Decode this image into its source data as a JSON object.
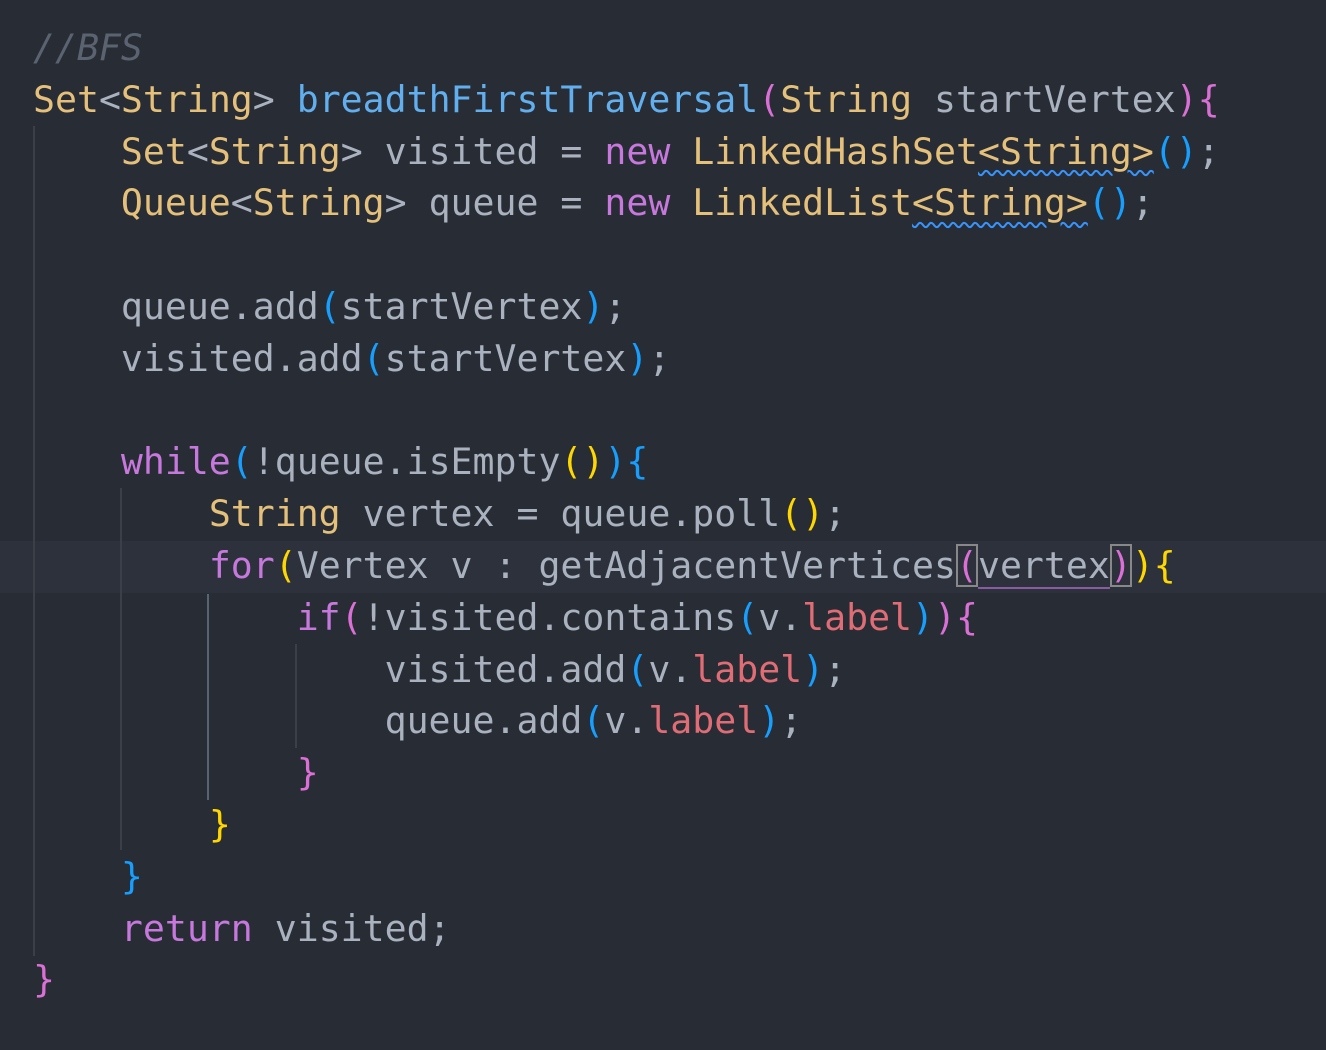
{
  "editor": {
    "language": "java",
    "colors": {
      "background": "#282c34",
      "current_line": "#2c313c",
      "comment": "#5c6370",
      "type": "#e5c07b",
      "function": "#61afef",
      "keyword": "#c678dd",
      "property": "#e06c75",
      "text": "#abb2bf"
    },
    "lines": [
      {
        "tokens": [
          {
            "t": "//BFS",
            "c": "comment"
          }
        ]
      },
      {
        "tokens": [
          {
            "t": "Set",
            "c": "type"
          },
          {
            "t": "<",
            "c": "plain"
          },
          {
            "t": "String",
            "c": "type"
          },
          {
            "t": "> ",
            "c": "plain"
          },
          {
            "t": "breadthFirstTraversal",
            "c": "fn"
          },
          {
            "t": "(",
            "c": "bp"
          },
          {
            "t": "String",
            "c": "type"
          },
          {
            "t": " startVertex",
            "c": "plain"
          },
          {
            "t": "){",
            "c": "bp"
          }
        ]
      },
      {
        "tokens": [
          {
            "t": "    "
          },
          {
            "t": "Set",
            "c": "type"
          },
          {
            "t": "<",
            "c": "plain"
          },
          {
            "t": "String",
            "c": "type"
          },
          {
            "t": "> visited = ",
            "c": "plain"
          },
          {
            "t": "new",
            "c": "kw"
          },
          {
            "t": " ",
            "c": "plain"
          },
          {
            "t": "LinkedHashSet",
            "c": "type"
          },
          {
            "t": "<String>",
            "c": "type",
            "squiggle": true
          },
          {
            "t": "()",
            "c": "bb"
          },
          {
            "t": ";",
            "c": "plain"
          }
        ]
      },
      {
        "tokens": [
          {
            "t": "    "
          },
          {
            "t": "Queue",
            "c": "type"
          },
          {
            "t": "<",
            "c": "plain"
          },
          {
            "t": "String",
            "c": "type"
          },
          {
            "t": "> queue = ",
            "c": "plain"
          },
          {
            "t": "new",
            "c": "kw"
          },
          {
            "t": " ",
            "c": "plain"
          },
          {
            "t": "LinkedList",
            "c": "type"
          },
          {
            "t": "<String>",
            "c": "type",
            "squiggle": true
          },
          {
            "t": "()",
            "c": "bb"
          },
          {
            "t": ";",
            "c": "plain"
          }
        ]
      },
      {
        "tokens": []
      },
      {
        "tokens": [
          {
            "t": "    "
          },
          {
            "t": "queue.add",
            "c": "plain"
          },
          {
            "t": "(",
            "c": "bb"
          },
          {
            "t": "startVertex",
            "c": "plain"
          },
          {
            "t": ")",
            "c": "bb"
          },
          {
            "t": ";",
            "c": "plain"
          }
        ]
      },
      {
        "tokens": [
          {
            "t": "    "
          },
          {
            "t": "visited.add",
            "c": "plain"
          },
          {
            "t": "(",
            "c": "bb"
          },
          {
            "t": "startVertex",
            "c": "plain"
          },
          {
            "t": ")",
            "c": "bb"
          },
          {
            "t": ";",
            "c": "plain"
          }
        ]
      },
      {
        "tokens": []
      },
      {
        "tokens": [
          {
            "t": "    "
          },
          {
            "t": "while",
            "c": "kw"
          },
          {
            "t": "(",
            "c": "bb"
          },
          {
            "t": "!queue.isEmpty",
            "c": "plain"
          },
          {
            "t": "()",
            "c": "by"
          },
          {
            "t": "){",
            "c": "bb"
          }
        ]
      },
      {
        "tokens": [
          {
            "t": "        "
          },
          {
            "t": "String",
            "c": "type"
          },
          {
            "t": " vertex = queue.poll",
            "c": "plain"
          },
          {
            "t": "()",
            "c": "by"
          },
          {
            "t": ";",
            "c": "plain"
          }
        ]
      },
      {
        "tokens": [
          {
            "t": "        "
          },
          {
            "t": "for",
            "c": "kw"
          },
          {
            "t": "(",
            "c": "by"
          },
          {
            "t": "Vertex v : getAdjacentVertices",
            "c": "plain"
          },
          {
            "t": "(",
            "c": "bp",
            "match": true
          },
          {
            "t": "vertex",
            "c": "plain",
            "range": true
          },
          {
            "t": ")",
            "c": "bp",
            "match": true
          },
          {
            "t": ")",
            "c": "by"
          },
          {
            "t": "{",
            "c": "by"
          }
        ]
      },
      {
        "tokens": [
          {
            "t": "            "
          },
          {
            "t": "if",
            "c": "kw"
          },
          {
            "t": "(",
            "c": "bp"
          },
          {
            "t": "!visited.contains",
            "c": "plain"
          },
          {
            "t": "(",
            "c": "bb"
          },
          {
            "t": "v.",
            "c": "plain"
          },
          {
            "t": "label",
            "c": "prop"
          },
          {
            "t": ")",
            "c": "bb"
          },
          {
            "t": "){",
            "c": "bp"
          }
        ]
      },
      {
        "tokens": [
          {
            "t": "                "
          },
          {
            "t": "visited.add",
            "c": "plain"
          },
          {
            "t": "(",
            "c": "bb"
          },
          {
            "t": "v.",
            "c": "plain"
          },
          {
            "t": "label",
            "c": "prop"
          },
          {
            "t": ")",
            "c": "bb"
          },
          {
            "t": ";",
            "c": "plain"
          }
        ]
      },
      {
        "tokens": [
          {
            "t": "                "
          },
          {
            "t": "queue.add",
            "c": "plain"
          },
          {
            "t": "(",
            "c": "bb"
          },
          {
            "t": "v.",
            "c": "plain"
          },
          {
            "t": "label",
            "c": "prop"
          },
          {
            "t": ")",
            "c": "bb"
          },
          {
            "t": ";",
            "c": "plain"
          }
        ]
      },
      {
        "tokens": [
          {
            "t": "            "
          },
          {
            "t": "}",
            "c": "bp"
          }
        ]
      },
      {
        "tokens": [
          {
            "t": "        "
          },
          {
            "t": "}",
            "c": "by"
          }
        ]
      },
      {
        "tokens": [
          {
            "t": "    "
          },
          {
            "t": "}",
            "c": "bb"
          }
        ]
      },
      {
        "tokens": [
          {
            "t": "    "
          },
          {
            "t": "return",
            "c": "kw"
          },
          {
            "t": " visited;",
            "c": "plain"
          }
        ]
      },
      {
        "tokens": [
          {
            "t": "}",
            "c": "bp"
          }
        ]
      }
    ]
  }
}
